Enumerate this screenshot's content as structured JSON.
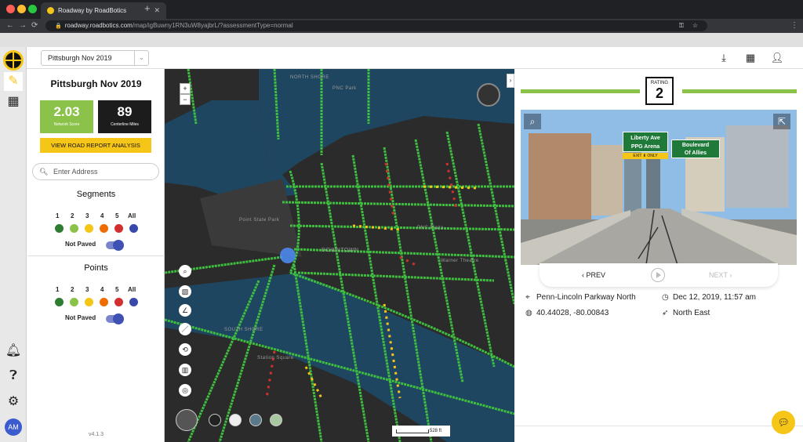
{
  "browser": {
    "tab_title": "Roadway by RoadBotics",
    "new_tab": "+",
    "url_host": "roadway.roadbotics.com",
    "url_path": "/map/igBuwny1RN3uW8yajbrL/?assessmentType=normal",
    "back": "←",
    "forward": "→",
    "reload": "C"
  },
  "topbar": {
    "assessment_select": "Pittsburgh Nov 2019",
    "download_icon": "download-icon",
    "grid_icon": "grid-icon",
    "account_icon": "account-settings-icon"
  },
  "rail": {
    "avatar_initials": "AM",
    "collapse_left": "‹",
    "collapse_right": "›"
  },
  "panel": {
    "title": "Pittsburgh Nov 2019",
    "network_score": "2.03",
    "network_score_label": "Network Score",
    "centerline_miles": "89",
    "centerline_miles_label": "Centerline Miles",
    "report_button": "VIEW ROAD REPORT ANALYSIS",
    "address_placeholder": "Enter Address",
    "segments": {
      "title": "Segments",
      "ratings": [
        "1",
        "2",
        "3",
        "4",
        "5",
        "All"
      ],
      "not_paved_label": "Not Paved"
    },
    "points": {
      "title": "Points",
      "ratings": [
        "1",
        "2",
        "3",
        "4",
        "5",
        "All"
      ],
      "not_paved_label": "Not Paved"
    },
    "version": "v4.1.3"
  },
  "rating_colors": [
    "#2e7d32",
    "#8bc34a",
    "#f5c518",
    "#ef6c00",
    "#d32f2f",
    "#3949ab"
  ],
  "map": {
    "zoom_in": "+",
    "zoom_out": "−",
    "labels": {
      "north_shore": "NORTH SHORE",
      "point_state_park": "Point State Park",
      "downtown": "DOWNTOWN",
      "south_shore": "SOUTH SHORE",
      "station_square": "Station Square",
      "pnc_park": "PNC Park",
      "ppg_place": "PNC Plaza",
      "warner": "Warner Theatre"
    },
    "scale": "528 ft"
  },
  "viewer": {
    "rating_label": "RATING",
    "rating_value": "2",
    "prev": "‹ PREV",
    "next": "NEXT ›",
    "sign_1_line1": "Liberty Ave",
    "sign_1_line2": "PPG Arena",
    "sign_1_exit": "EXIT ⬇ ONLY",
    "sign_2_line1": "Boulevard",
    "sign_2_line2": "Of Allies",
    "street": "Penn-Lincoln Parkway North",
    "timestamp": "Dec 12, 2019, 11:57 am",
    "coordinates": "40.44028, -80.00843",
    "direction": "North East"
  }
}
